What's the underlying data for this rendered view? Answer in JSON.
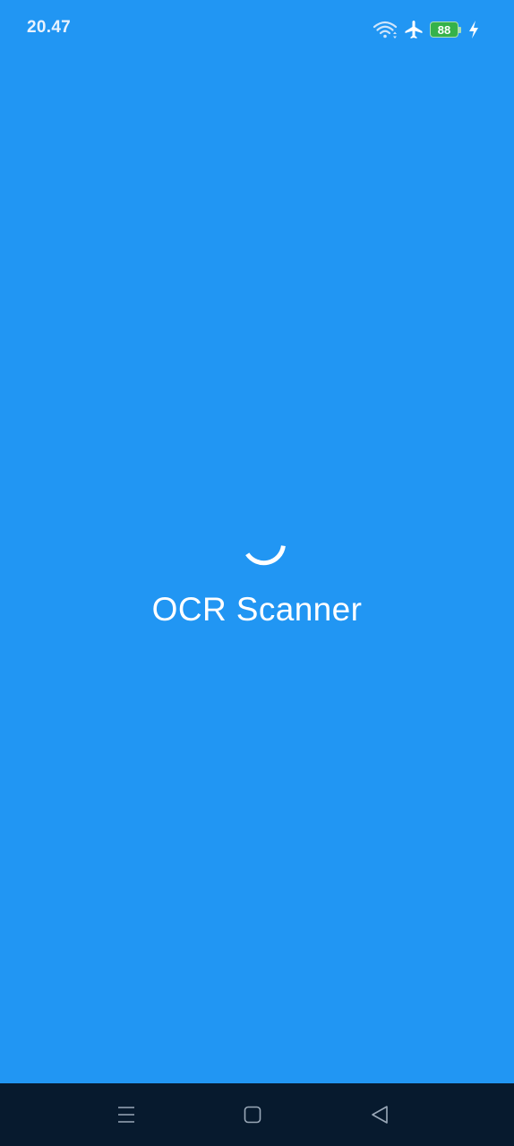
{
  "status_bar": {
    "time": "20.47",
    "battery_level": "88",
    "icons": [
      "wifi-icon",
      "airplane-mode-icon",
      "battery-icon",
      "charging-bolt-icon"
    ]
  },
  "splash": {
    "title": "OCR Scanner",
    "loading_indicator": "circular-progress-spinner"
  },
  "nav_bar": {
    "buttons": [
      "menu-icon",
      "home-icon",
      "back-icon"
    ]
  },
  "colors": {
    "background": "#2196F3",
    "nav_bar": "#071a2e",
    "battery": "#35b24a",
    "text": "#ffffff"
  }
}
